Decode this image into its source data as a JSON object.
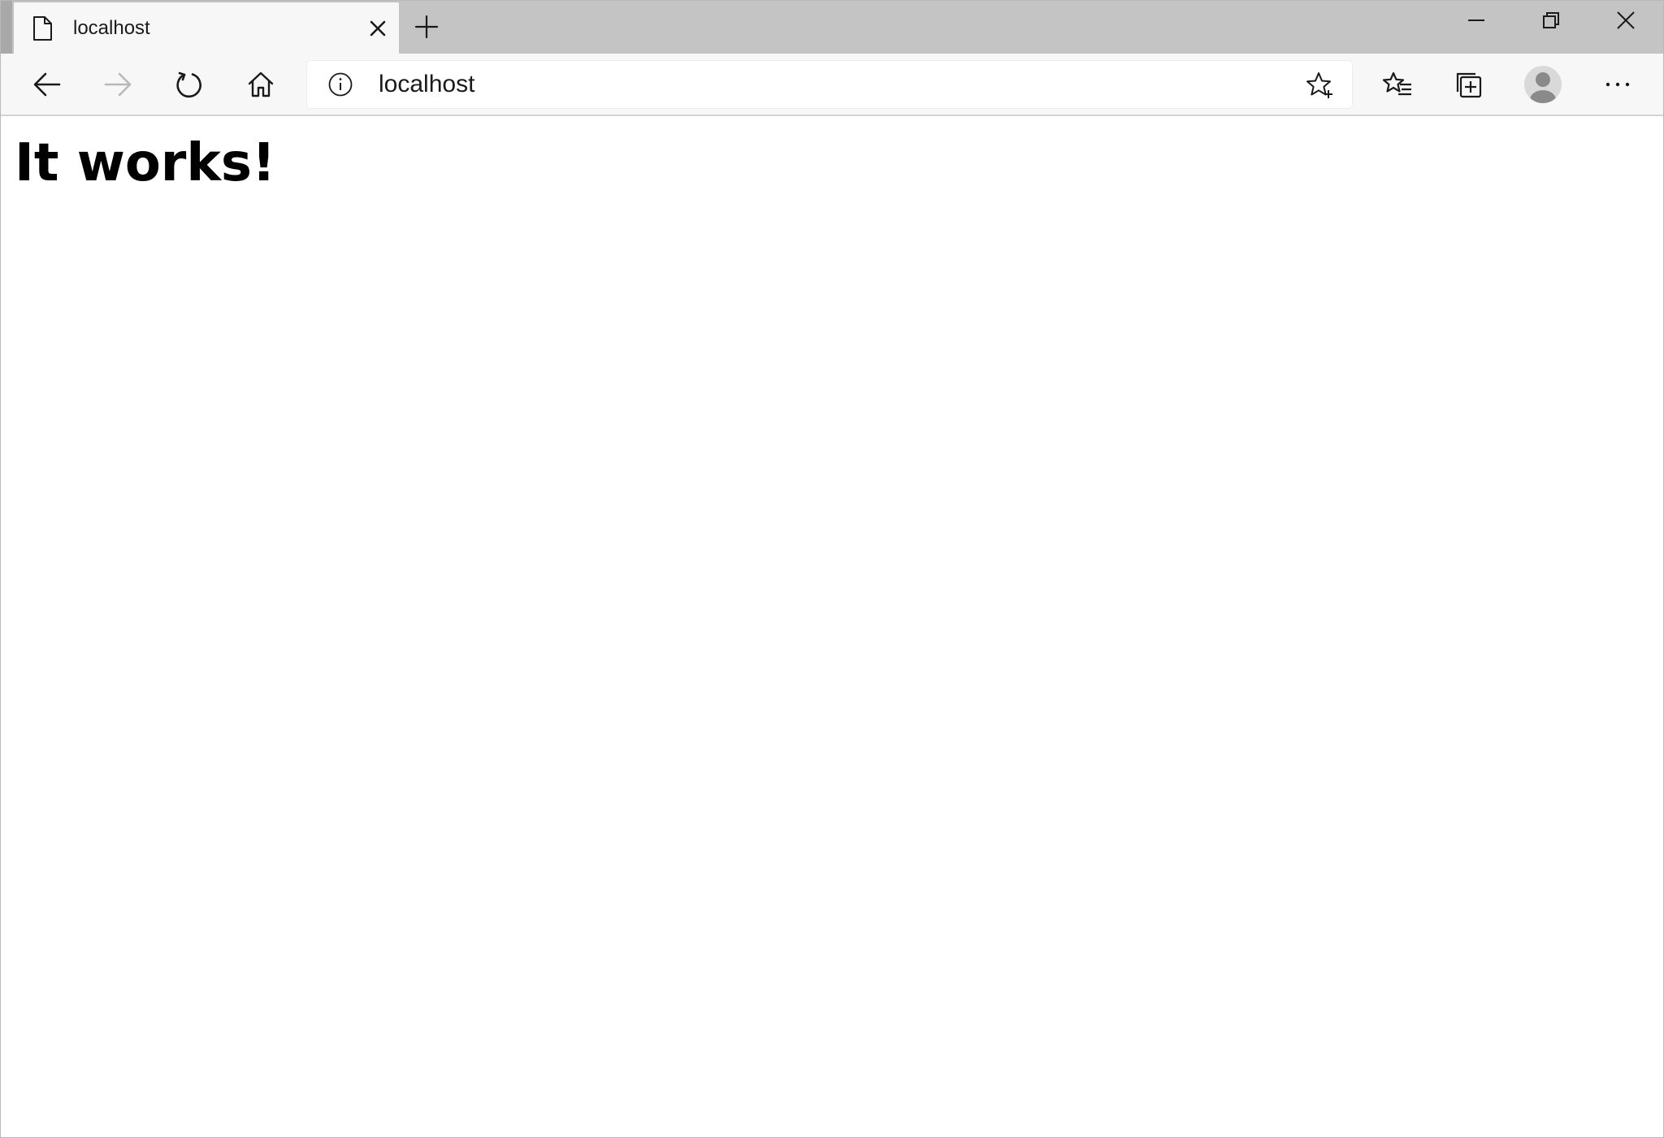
{
  "browser": {
    "tab": {
      "title": "localhost",
      "icon": "page-icon"
    },
    "address_bar": {
      "url": "localhost",
      "info_icon": "info-icon",
      "favorite_icon": "star-add-icon"
    },
    "toolbar_icons": [
      "back-arrow-icon",
      "forward-arrow-icon",
      "refresh-icon",
      "home-icon",
      "favorites-icon",
      "collections-icon",
      "profile-avatar-icon",
      "more-icon"
    ],
    "window_controls": [
      "minimize-icon",
      "restore-icon",
      "close-icon"
    ]
  },
  "page": {
    "heading": "It works!"
  },
  "colors": {
    "tab_strip": "#c4c4c4",
    "active_tab": "#f7f7f7",
    "toolbar": "#f7f7f7",
    "icon": "#1a1a1a",
    "icon_disabled": "#b8b8b8",
    "page_background": "#ffffff"
  }
}
